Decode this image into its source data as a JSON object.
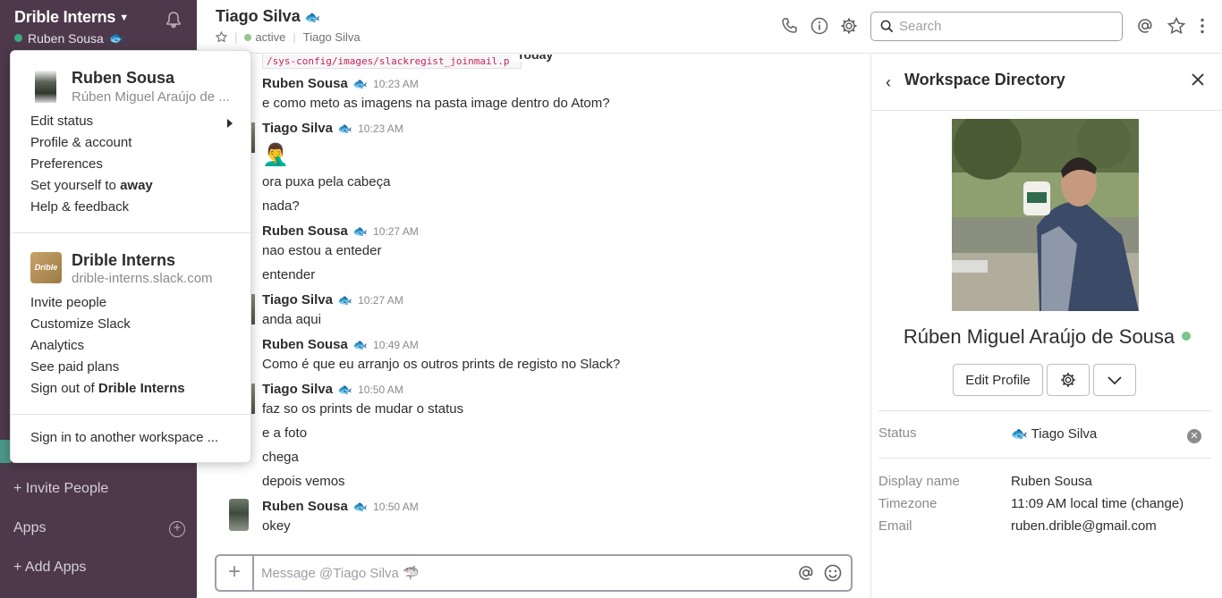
{
  "sidebar": {
    "workspace_name": "Drible Interns",
    "user_name": "Ruben Sousa",
    "user_emoji": "🐟",
    "links": {
      "invite": "+ Invite People",
      "apps": "Apps",
      "add_apps": "+ Add Apps"
    }
  },
  "header": {
    "title": "Tiago Silva",
    "title_emoji": "🐟",
    "status": "active",
    "display_name": "Tiago Silva",
    "search_placeholder": "Search"
  },
  "messages": {
    "today_label": "Today",
    "code_snippet": "/sys-config/images/slackregist_joinmail.p",
    "items": [
      {
        "author": "Ruben Sousa",
        "emoji": "🐟",
        "time": "10:23 AM",
        "lines": [
          "e como meto as imagens na pasta image dentro do Atom?"
        ]
      },
      {
        "author": "Tiago Silva",
        "emoji": "🐟",
        "time": "10:23 AM",
        "emoji_line": "🤦‍♂️",
        "lines": [
          "ora puxa pela cabeça",
          "nada?"
        ]
      },
      {
        "author": "Ruben Sousa",
        "emoji": "🐟",
        "time": "10:27 AM",
        "lines": [
          "nao estou a enteder",
          "entender"
        ]
      },
      {
        "author": "Tiago Silva",
        "emoji": "🐟",
        "time": "10:27 AM",
        "lines": [
          "anda aqui"
        ]
      },
      {
        "author": "Ruben Sousa",
        "emoji": "🐟",
        "time": "10:49 AM",
        "lines": [
          "Como é que eu arranjo os outros prints de registo no Slack?"
        ]
      },
      {
        "author": "Tiago Silva",
        "emoji": "🐟",
        "time": "10:50 AM",
        "lines": [
          "faz so os prints de mudar o status",
          "e a foto",
          "chega",
          "depois vemos"
        ]
      },
      {
        "author": "Ruben Sousa",
        "emoji": "🐟",
        "time": "10:50 AM",
        "lines": [
          "okey"
        ]
      }
    ]
  },
  "composer": {
    "placeholder": "Message @Tiago Silva 🦈"
  },
  "panel": {
    "title": "Workspace Directory",
    "full_name": "Rúben Miguel Araújo de Sousa",
    "edit_profile": "Edit Profile",
    "status_label": "Status",
    "status_emoji": "🐟",
    "status_value": "Tiago Silva",
    "display_name_label": "Display name",
    "display_name_value": "Ruben Sousa",
    "timezone_label": "Timezone",
    "timezone_value": "11:09 AM local time (change)",
    "email_label": "Email",
    "email_value": "ruben.drible@gmail.com"
  },
  "menu": {
    "user_name": "Ruben Sousa",
    "user_full": "Rúben Miguel Araújo de ...",
    "user_items": {
      "edit_status": "Edit status",
      "profile": "Profile & account",
      "preferences": "Preferences",
      "away_prefix": "Set yourself to ",
      "away_bold": "away",
      "help": "Help & feedback"
    },
    "workspace_name": "Drible Interns",
    "workspace_url": "drible-interns.slack.com",
    "workspace_logo_text": "Drible",
    "ws_items": {
      "invite": "Invite people",
      "customize": "Customize Slack",
      "analytics": "Analytics",
      "paid": "See paid plans",
      "signout_prefix": "Sign out of ",
      "signout_bold": "Drible Interns"
    },
    "signin_other": "Sign in to another workspace ..."
  },
  "colors": {
    "sidebar": "#4d394b",
    "presence": "#3daa7e",
    "accent_teal": "#4c9689"
  }
}
